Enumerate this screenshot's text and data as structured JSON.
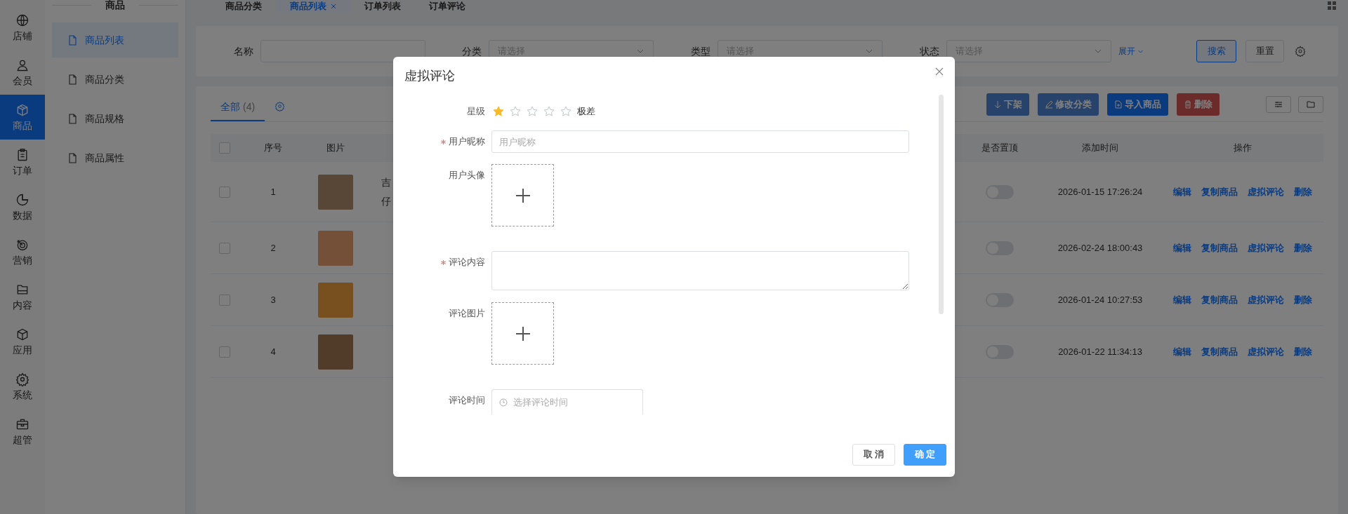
{
  "rail": [
    {
      "label": "店铺",
      "selected": false
    },
    {
      "label": "会员",
      "selected": false
    },
    {
      "label": "商品",
      "selected": true
    },
    {
      "label": "订单",
      "selected": false
    },
    {
      "label": "数据",
      "selected": false
    },
    {
      "label": "营销",
      "selected": false
    },
    {
      "label": "内容",
      "selected": false
    },
    {
      "label": "应用",
      "selected": false
    },
    {
      "label": "系统",
      "selected": false
    },
    {
      "label": "超管",
      "selected": false
    }
  ],
  "submenu": {
    "title": "商品",
    "items": [
      {
        "label": "商品列表",
        "selected": true
      },
      {
        "label": "商品分类",
        "selected": false
      },
      {
        "label": "商品规格",
        "selected": false
      },
      {
        "label": "商品属性",
        "selected": false
      }
    ]
  },
  "tabs": [
    {
      "label": "商品分类",
      "selected": false,
      "closable": false
    },
    {
      "label": "商品列表",
      "selected": true,
      "closable": true
    },
    {
      "label": "订单列表",
      "selected": false,
      "closable": false
    },
    {
      "label": "订单评论",
      "selected": false,
      "closable": false
    }
  ],
  "filters": [
    {
      "label": "名称",
      "kind": "input"
    },
    {
      "label": "分类",
      "kind": "select",
      "placeholder": "请选择"
    },
    {
      "label": "类型",
      "kind": "select",
      "placeholder": "请选择"
    },
    {
      "label": "状态",
      "kind": "select",
      "placeholder": "请选择"
    }
  ],
  "expand_link": "展开",
  "search_button": "搜索",
  "reset_button": "重置",
  "list_tabs": [
    {
      "label": "全部",
      "count": "(4)",
      "selected": true
    }
  ],
  "toolbar": [
    {
      "label": "下架",
      "kind": "primary",
      "disabled": true
    },
    {
      "label": "修改分类",
      "kind": "primary",
      "disabled": true
    },
    {
      "label": "导入商品",
      "kind": "primary",
      "disabled": false
    },
    {
      "label": "删除",
      "kind": "danger",
      "disabled": true
    }
  ],
  "table": {
    "header_checked": false,
    "columns_left": [
      "序号",
      "图片"
    ],
    "columns_right": [
      "是否置顶",
      "添加时间",
      "操作"
    ],
    "rows": [
      {
        "checked": false,
        "index": "1",
        "name_lines": [
          "吉",
          "仔"
        ],
        "pinned": false,
        "added": "2026-01-15 17:26:24",
        "actions": [
          "编辑",
          "复制商品",
          "虚拟评论",
          "删除"
        ]
      },
      {
        "checked": false,
        "index": "2",
        "name_lines": [],
        "pinned": false,
        "added": "2026-02-24 18:00:43",
        "actions": [
          "编辑",
          "复制商品",
          "虚拟评论",
          "删除"
        ]
      },
      {
        "checked": false,
        "index": "3",
        "name_lines": [],
        "pinned": false,
        "added": "2026-01-24 10:27:53",
        "actions": [
          "编辑",
          "复制商品",
          "虚拟评论",
          "删除"
        ]
      },
      {
        "checked": false,
        "index": "4",
        "name_lines": [],
        "pinned": false,
        "added": "2026-01-22 11:34:13",
        "actions": [
          "编辑",
          "复制商品",
          "虚拟评论",
          "删除"
        ]
      }
    ]
  },
  "modal": {
    "title": "虚拟评论",
    "fields": [
      {
        "kind": "rating",
        "label": "星级",
        "required": false,
        "stars": 1,
        "rating_text": "极差"
      },
      {
        "kind": "input",
        "label": "用户昵称",
        "required": true,
        "placeholder": "用户昵称"
      },
      {
        "kind": "upload",
        "label": "用户头像",
        "required": false
      },
      {
        "kind": "textarea",
        "label": "评论内容",
        "required": true
      },
      {
        "kind": "upload",
        "label": "评论图片",
        "required": false
      },
      {
        "kind": "datetime",
        "label": "评论时间",
        "required": false,
        "placeholder": "选择评论时间"
      }
    ],
    "buttons": [
      {
        "label": "取 消",
        "kind": "default"
      },
      {
        "label": "确 定",
        "kind": "primary"
      }
    ]
  }
}
